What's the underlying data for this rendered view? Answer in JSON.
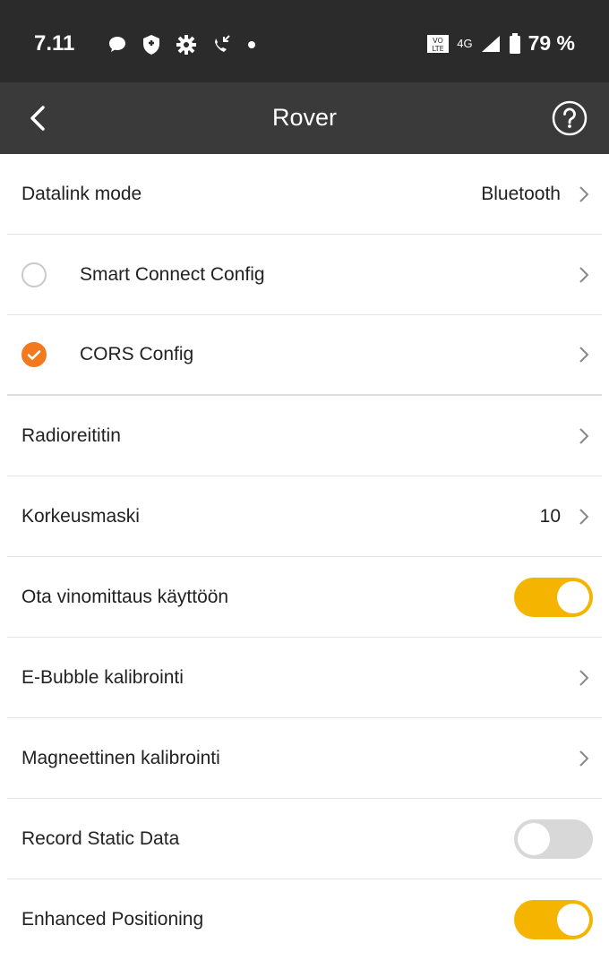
{
  "status_bar": {
    "time": "7.11",
    "network": "4G",
    "battery": "79 %"
  },
  "app_bar": {
    "title": "Rover"
  },
  "rows": [
    {
      "label": "Datalink mode",
      "value": "Bluetooth"
    },
    {
      "label": "Smart Connect Config",
      "selected": false
    },
    {
      "label": "CORS Config",
      "selected": true
    },
    {
      "label": "Radioreititin"
    },
    {
      "label": "Korkeusmaski",
      "value": "10"
    },
    {
      "label": "Ota vinomittaus käyttöön",
      "toggle": true
    },
    {
      "label": "E-Bubble kalibrointi"
    },
    {
      "label": "Magneettinen kalibrointi"
    },
    {
      "label": "Record Static Data",
      "toggle": false
    },
    {
      "label": "Enhanced Positioning",
      "toggle": true
    }
  ],
  "colors": {
    "accent_toggle": "#f5b400",
    "radio_checked": "#f3791f",
    "toggle_off": "#d8d8d8"
  }
}
